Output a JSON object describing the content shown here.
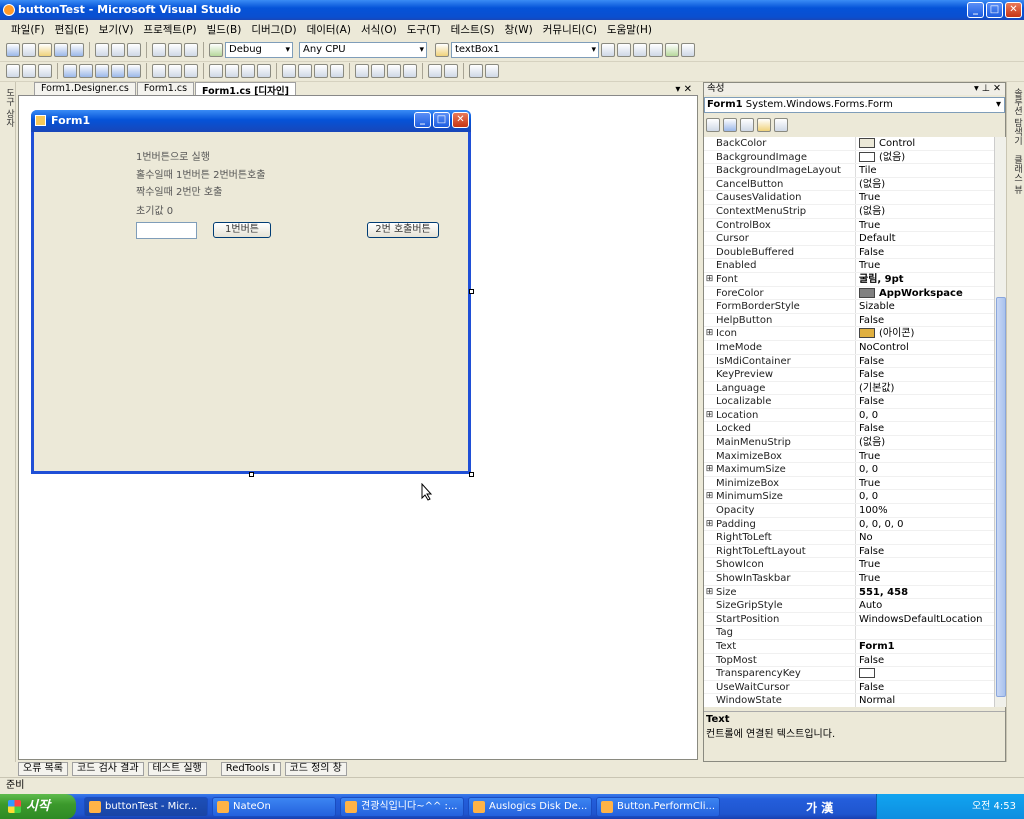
{
  "window": {
    "title": "buttonTest - Microsoft Visual Studio"
  },
  "menu": [
    "파일(F)",
    "편집(E)",
    "보기(V)",
    "프로젝트(P)",
    "빌드(B)",
    "디버그(D)",
    "데이터(A)",
    "서식(O)",
    "도구(T)",
    "테스트(S)",
    "창(W)",
    "커뮤니티(C)",
    "도움말(H)"
  ],
  "toolbar": {
    "config": "Debug",
    "platform": "Any CPU",
    "object": "textBox1"
  },
  "left_strip": {
    "toolbox": "도구 상자"
  },
  "tabs": [
    "Form1.Designer.cs",
    "Form1.cs",
    "Form1.cs [디자인]"
  ],
  "form": {
    "title": "Form1",
    "labels": [
      "1번버튼으로 실행",
      "홀수일때 1번버튼 2번버튼호출",
      "짝수일때 2번만 호출",
      "초기값 0"
    ],
    "button1": "1번버튼",
    "button2": "2번 호출버튼"
  },
  "properties": {
    "header": "속성",
    "object": "Form1",
    "object_type": "System.Windows.Forms.Form",
    "rows": [
      {
        "k": "BackColor",
        "v": "Control",
        "sw": "#ece9d8"
      },
      {
        "k": "BackgroundImage",
        "v": "(없음)",
        "sw": "#ffffff"
      },
      {
        "k": "BackgroundImageLayout",
        "v": "Tile"
      },
      {
        "k": "CancelButton",
        "v": "(없음)"
      },
      {
        "k": "CausesValidation",
        "v": "True"
      },
      {
        "k": "ContextMenuStrip",
        "v": "(없음)"
      },
      {
        "k": "ControlBox",
        "v": "True"
      },
      {
        "k": "Cursor",
        "v": "Default"
      },
      {
        "k": "DoubleBuffered",
        "v": "False"
      },
      {
        "k": "Enabled",
        "v": "True"
      },
      {
        "k": "Font",
        "v": "굴림, 9pt",
        "e": true,
        "b": true
      },
      {
        "k": "ForeColor",
        "v": "AppWorkspace",
        "sw": "#808080",
        "b": true
      },
      {
        "k": "FormBorderStyle",
        "v": "Sizable"
      },
      {
        "k": "HelpButton",
        "v": "False"
      },
      {
        "k": "Icon",
        "v": "(아이콘)",
        "e": true,
        "sw": "#e0b040"
      },
      {
        "k": "ImeMode",
        "v": "NoControl"
      },
      {
        "k": "IsMdiContainer",
        "v": "False"
      },
      {
        "k": "KeyPreview",
        "v": "False"
      },
      {
        "k": "Language",
        "v": "(기본값)"
      },
      {
        "k": "Localizable",
        "v": "False"
      },
      {
        "k": "Location",
        "v": "0, 0",
        "e": true
      },
      {
        "k": "Locked",
        "v": "False"
      },
      {
        "k": "MainMenuStrip",
        "v": "(없음)"
      },
      {
        "k": "MaximizeBox",
        "v": "True"
      },
      {
        "k": "MaximumSize",
        "v": "0, 0",
        "e": true
      },
      {
        "k": "MinimizeBox",
        "v": "True"
      },
      {
        "k": "MinimumSize",
        "v": "0, 0",
        "e": true
      },
      {
        "k": "Opacity",
        "v": "100%"
      },
      {
        "k": "Padding",
        "v": "0, 0, 0, 0",
        "e": true
      },
      {
        "k": "RightToLeft",
        "v": "No"
      },
      {
        "k": "RightToLeftLayout",
        "v": "False"
      },
      {
        "k": "ShowIcon",
        "v": "True"
      },
      {
        "k": "ShowInTaskbar",
        "v": "True"
      },
      {
        "k": "Size",
        "v": "551, 458",
        "e": true,
        "b": true
      },
      {
        "k": "SizeGripStyle",
        "v": "Auto"
      },
      {
        "k": "StartPosition",
        "v": "WindowsDefaultLocation"
      },
      {
        "k": "Tag",
        "v": ""
      },
      {
        "k": "Text",
        "v": "Form1",
        "b": true
      },
      {
        "k": "TopMost",
        "v": "False"
      },
      {
        "k": "TransparencyKey",
        "v": "",
        "sw": "#ffffff"
      },
      {
        "k": "UseWaitCursor",
        "v": "False"
      },
      {
        "k": "WindowState",
        "v": "Normal"
      }
    ],
    "desc_title": "Text",
    "desc_body": "컨트롤에 연결된 텍스트입니다."
  },
  "right_strip": {
    "a": "솔루션 탐색기",
    "b": "클래스 뷰"
  },
  "bottom_tabs": [
    "오류 목록",
    "코드 검사 결과",
    "테스트 실행",
    "RedTools I",
    "코드 정의 창"
  ],
  "status": "준비",
  "taskbar": {
    "start": "시작",
    "items": [
      "buttonTest - Micr...",
      "NateOn",
      "견광식입니다~^^ :...",
      "Auslogics Disk De...",
      "Button.PerformCli..."
    ],
    "ime": "가 漢",
    "clock": "오전 4:53"
  }
}
